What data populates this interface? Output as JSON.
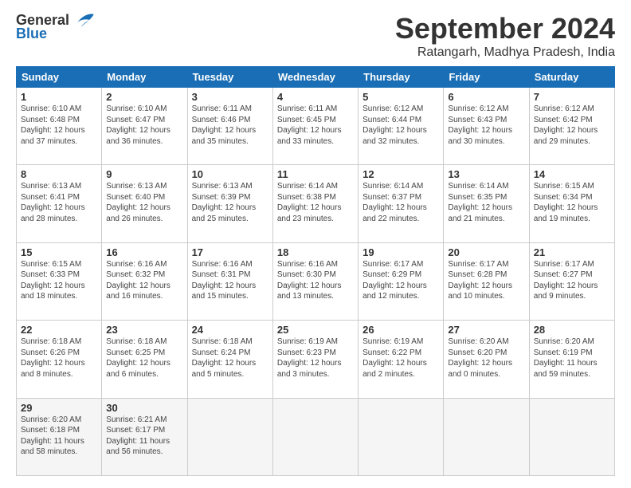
{
  "header": {
    "logo_general": "General",
    "logo_blue": "Blue",
    "month_title": "September 2024",
    "location": "Ratangarh, Madhya Pradesh, India"
  },
  "days_of_week": [
    "Sunday",
    "Monday",
    "Tuesday",
    "Wednesday",
    "Thursday",
    "Friday",
    "Saturday"
  ],
  "weeks": [
    [
      {
        "day": "1",
        "sunrise": "6:10 AM",
        "sunset": "6:48 PM",
        "daylight": "12 hours and 37 minutes."
      },
      {
        "day": "2",
        "sunrise": "6:10 AM",
        "sunset": "6:47 PM",
        "daylight": "12 hours and 36 minutes."
      },
      {
        "day": "3",
        "sunrise": "6:11 AM",
        "sunset": "6:46 PM",
        "daylight": "12 hours and 35 minutes."
      },
      {
        "day": "4",
        "sunrise": "6:11 AM",
        "sunset": "6:45 PM",
        "daylight": "12 hours and 33 minutes."
      },
      {
        "day": "5",
        "sunrise": "6:12 AM",
        "sunset": "6:44 PM",
        "daylight": "12 hours and 32 minutes."
      },
      {
        "day": "6",
        "sunrise": "6:12 AM",
        "sunset": "6:43 PM",
        "daylight": "12 hours and 30 minutes."
      },
      {
        "day": "7",
        "sunrise": "6:12 AM",
        "sunset": "6:42 PM",
        "daylight": "12 hours and 29 minutes."
      }
    ],
    [
      {
        "day": "8",
        "sunrise": "6:13 AM",
        "sunset": "6:41 PM",
        "daylight": "12 hours and 28 minutes."
      },
      {
        "day": "9",
        "sunrise": "6:13 AM",
        "sunset": "6:40 PM",
        "daylight": "12 hours and 26 minutes."
      },
      {
        "day": "10",
        "sunrise": "6:13 AM",
        "sunset": "6:39 PM",
        "daylight": "12 hours and 25 minutes."
      },
      {
        "day": "11",
        "sunrise": "6:14 AM",
        "sunset": "6:38 PM",
        "daylight": "12 hours and 23 minutes."
      },
      {
        "day": "12",
        "sunrise": "6:14 AM",
        "sunset": "6:37 PM",
        "daylight": "12 hours and 22 minutes."
      },
      {
        "day": "13",
        "sunrise": "6:14 AM",
        "sunset": "6:35 PM",
        "daylight": "12 hours and 21 minutes."
      },
      {
        "day": "14",
        "sunrise": "6:15 AM",
        "sunset": "6:34 PM",
        "daylight": "12 hours and 19 minutes."
      }
    ],
    [
      {
        "day": "15",
        "sunrise": "6:15 AM",
        "sunset": "6:33 PM",
        "daylight": "12 hours and 18 minutes."
      },
      {
        "day": "16",
        "sunrise": "6:16 AM",
        "sunset": "6:32 PM",
        "daylight": "12 hours and 16 minutes."
      },
      {
        "day": "17",
        "sunrise": "6:16 AM",
        "sunset": "6:31 PM",
        "daylight": "12 hours and 15 minutes."
      },
      {
        "day": "18",
        "sunrise": "6:16 AM",
        "sunset": "6:30 PM",
        "daylight": "12 hours and 13 minutes."
      },
      {
        "day": "19",
        "sunrise": "6:17 AM",
        "sunset": "6:29 PM",
        "daylight": "12 hours and 12 minutes."
      },
      {
        "day": "20",
        "sunrise": "6:17 AM",
        "sunset": "6:28 PM",
        "daylight": "12 hours and 10 minutes."
      },
      {
        "day": "21",
        "sunrise": "6:17 AM",
        "sunset": "6:27 PM",
        "daylight": "12 hours and 9 minutes."
      }
    ],
    [
      {
        "day": "22",
        "sunrise": "6:18 AM",
        "sunset": "6:26 PM",
        "daylight": "12 hours and 8 minutes."
      },
      {
        "day": "23",
        "sunrise": "6:18 AM",
        "sunset": "6:25 PM",
        "daylight": "12 hours and 6 minutes."
      },
      {
        "day": "24",
        "sunrise": "6:18 AM",
        "sunset": "6:24 PM",
        "daylight": "12 hours and 5 minutes."
      },
      {
        "day": "25",
        "sunrise": "6:19 AM",
        "sunset": "6:23 PM",
        "daylight": "12 hours and 3 minutes."
      },
      {
        "day": "26",
        "sunrise": "6:19 AM",
        "sunset": "6:22 PM",
        "daylight": "12 hours and 2 minutes."
      },
      {
        "day": "27",
        "sunrise": "6:20 AM",
        "sunset": "6:20 PM",
        "daylight": "12 hours and 0 minutes."
      },
      {
        "day": "28",
        "sunrise": "6:20 AM",
        "sunset": "6:19 PM",
        "daylight": "11 hours and 59 minutes."
      }
    ],
    [
      {
        "day": "29",
        "sunrise": "6:20 AM",
        "sunset": "6:18 PM",
        "daylight": "11 hours and 58 minutes."
      },
      {
        "day": "30",
        "sunrise": "6:21 AM",
        "sunset": "6:17 PM",
        "daylight": "11 hours and 56 minutes."
      },
      null,
      null,
      null,
      null,
      null
    ]
  ]
}
